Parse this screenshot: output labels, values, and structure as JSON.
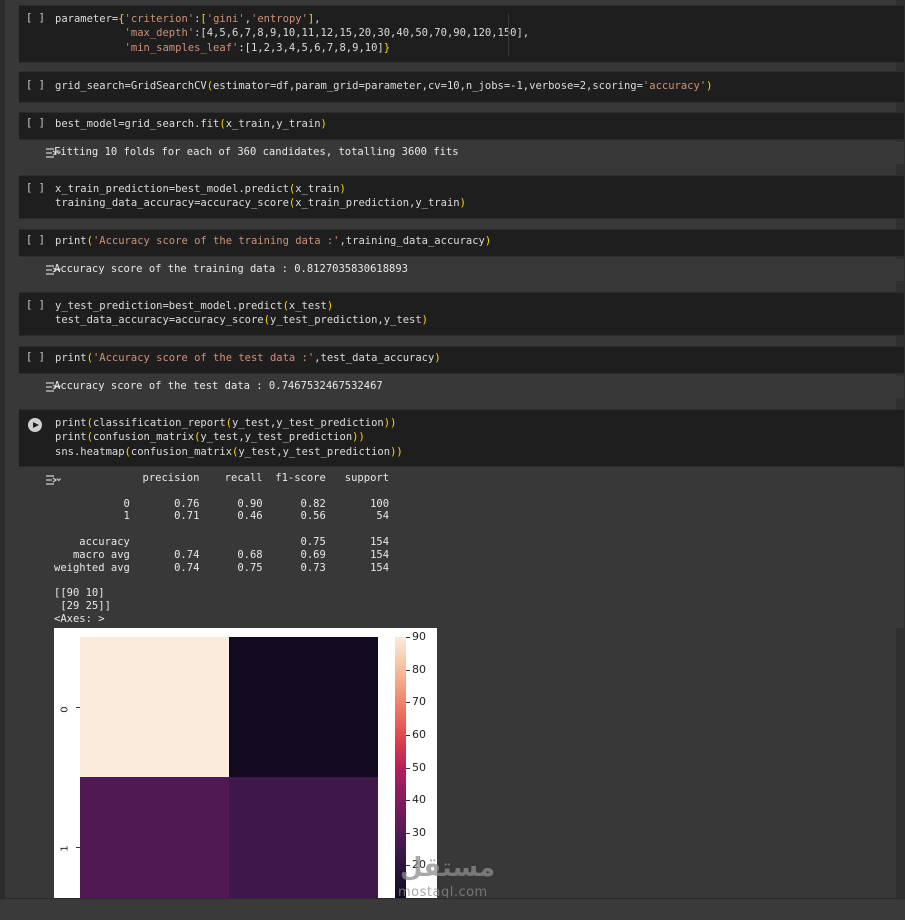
{
  "cells": [
    {
      "run_label": "[ ]",
      "lines": [
        [
          {
            "t": "parameter="
          },
          {
            "t": "{",
            "c": "b"
          },
          {
            "t": "'criterion'",
            "c": "s"
          },
          {
            "t": ":"
          },
          {
            "t": "[",
            "c": "b"
          },
          {
            "t": "'gini'",
            "c": "s"
          },
          {
            "t": ","
          },
          {
            "t": "'entropy'",
            "c": "s"
          },
          {
            "t": "]",
            "c": "b"
          },
          {
            "t": ","
          }
        ],
        [
          {
            "t": "           "
          },
          {
            "t": "'max_depth'",
            "c": "s"
          },
          {
            "t": ":[4,5,6,7,8,9,10,11,12,15,20,30,40,50,70,90,120,150],"
          }
        ],
        [
          {
            "t": "           "
          },
          {
            "t": "'min_samples_leaf'",
            "c": "s"
          },
          {
            "t": ":[1,2,3,4,5,6,7,8,9,10]"
          },
          {
            "t": "}",
            "c": "b"
          }
        ]
      ]
    },
    {
      "run_label": "[ ]",
      "lines": [
        [
          {
            "t": "grid_search=GridSearchCV"
          },
          {
            "t": "(",
            "c": "b"
          },
          {
            "t": "estimator=df,param_grid=parameter,cv=10,n_jobs=-1,verbose=2,scoring="
          },
          {
            "t": "'accuracy'",
            "c": "s"
          },
          {
            "t": ")",
            "c": "b"
          }
        ]
      ]
    },
    {
      "run_label": "[ ]",
      "lines": [
        [
          {
            "t": "best_model=grid_search.fit"
          },
          {
            "t": "(",
            "c": "b"
          },
          {
            "t": "x_train,y_train"
          },
          {
            "t": ")",
            "c": "b"
          }
        ]
      ]
    },
    {
      "run_label": "[ ]",
      "lines": [
        [
          {
            "t": "x_train_prediction=best_model.predict"
          },
          {
            "t": "(",
            "c": "b"
          },
          {
            "t": "x_train"
          },
          {
            "t": ")",
            "c": "b"
          }
        ],
        [
          {
            "t": "training_data_accuracy=accuracy_score"
          },
          {
            "t": "(",
            "c": "b"
          },
          {
            "t": "x_train_prediction,y_train"
          },
          {
            "t": ")",
            "c": "b"
          }
        ]
      ]
    },
    {
      "run_label": "[ ]",
      "lines": [
        [
          {
            "t": "print"
          },
          {
            "t": "(",
            "c": "b"
          },
          {
            "t": "'Accuracy score of the training data :'",
            "c": "s"
          },
          {
            "t": ",training_data_accuracy"
          },
          {
            "t": ")",
            "c": "b"
          }
        ]
      ]
    },
    {
      "run_label": "[ ]",
      "lines": [
        [
          {
            "t": "y_test_prediction=best_model.predict"
          },
          {
            "t": "(",
            "c": "b"
          },
          {
            "t": "x_test"
          },
          {
            "t": ")",
            "c": "b"
          }
        ],
        [
          {
            "t": "test_data_accuracy=accuracy_score"
          },
          {
            "t": "(",
            "c": "b"
          },
          {
            "t": "y_test_prediction,y_test"
          },
          {
            "t": ")",
            "c": "b"
          }
        ]
      ]
    },
    {
      "run_label": "[ ]",
      "lines": [
        [
          {
            "t": "print"
          },
          {
            "t": "(",
            "c": "b"
          },
          {
            "t": "'Accuracy score of the test data :'",
            "c": "s"
          },
          {
            "t": ",test_data_accuracy"
          },
          {
            "t": ")",
            "c": "b"
          }
        ]
      ]
    },
    {
      "run_label": "",
      "lines": [
        [
          {
            "t": "print"
          },
          {
            "t": "(",
            "c": "b"
          },
          {
            "t": "classification_report"
          },
          {
            "t": "(",
            "c": "b"
          },
          {
            "t": "y_test,y_test_prediction"
          },
          {
            "t": "))",
            "c": "b"
          }
        ],
        [
          {
            "t": "print"
          },
          {
            "t": "(",
            "c": "b"
          },
          {
            "t": "confusion_matrix"
          },
          {
            "t": "(",
            "c": "b"
          },
          {
            "t": "y_test,y_test_prediction"
          },
          {
            "t": "))",
            "c": "b"
          }
        ],
        [
          {
            "t": "sns.heatmap"
          },
          {
            "t": "(",
            "c": "b"
          },
          {
            "t": "confusion_matrix"
          },
          {
            "t": "(",
            "c": "b"
          },
          {
            "t": "y_test,y_test_prediction"
          },
          {
            "t": "))",
            "c": "b"
          }
        ]
      ]
    }
  ],
  "outputs": {
    "fit": "Fitting 10 folds for each of 360 candidates, totalling 3600 fits",
    "train_acc": "Accuracy score of the training data : 0.8127035830618893",
    "test_acc": "Accuracy score of the test data : 0.7467532467532467",
    "report": "              precision    recall  f1-score   support\n\n           0       0.76      0.90      0.82       100\n           1       0.71      0.46      0.56        54\n\n    accuracy                           0.75       154\n   macro avg       0.74      0.68      0.69       154\nweighted avg       0.74      0.75      0.73       154\n\n[[90 10]\n [29 25]]\n<Axes: >"
  },
  "chart_data": {
    "type": "heatmap",
    "matrix": [
      [
        90,
        10
      ],
      [
        29,
        25
      ]
    ],
    "yticklabels": [
      "0",
      "1"
    ],
    "colorbar_ticks": [
      90,
      80,
      70,
      60,
      50,
      40,
      30,
      20
    ],
    "colorbar_range": [
      10,
      90
    ],
    "colormap": "rocket"
  },
  "watermark": {
    "arabic": "مستقل",
    "latin": "mostaql.com"
  }
}
